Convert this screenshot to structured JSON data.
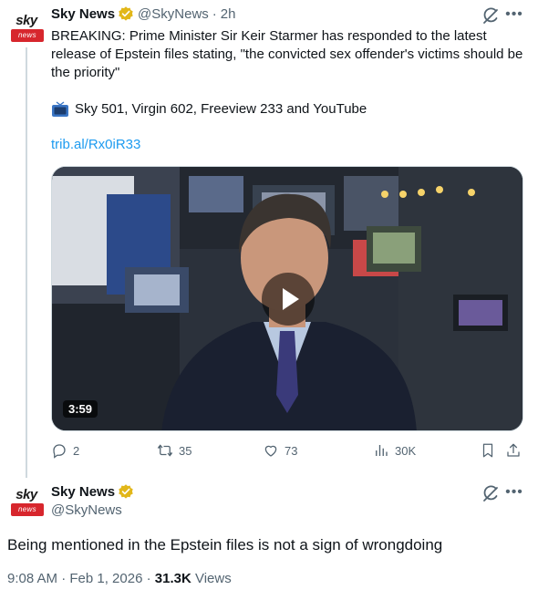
{
  "tweet1": {
    "avatar": {
      "line1": "sky",
      "line2": "news"
    },
    "name": "Sky News",
    "handle": "@SkyNews",
    "separator": "·",
    "time": "2h",
    "text": "BREAKING: Prime Minister Sir Keir Starmer has responded to the latest release of Epstein files stating, \"the convicted sex offender's victims should be the priority\"",
    "channels": "Sky 501, Virgin 602, Freeview 233 and YouTube",
    "link": "trib.al/Rx0iR33",
    "video": {
      "duration": "3:59"
    },
    "actions": {
      "replies": "2",
      "reposts": "35",
      "likes": "73",
      "views": "30K"
    }
  },
  "tweet2": {
    "avatar": {
      "line1": "sky",
      "line2": "news"
    },
    "name": "Sky News",
    "handle": "@SkyNews",
    "text": "Being mentioned in the Epstein files is not a sign of wrongdoing",
    "timestamp": "9:08 AM · Feb 1, 2026 · ",
    "views_count": "31.3K",
    "views_label": " Views"
  },
  "colors": {
    "verified": "#f4b400",
    "link": "#1d9bf0",
    "muted": "#536471",
    "brand_red": "#d7262d"
  },
  "icons": [
    "grok-icon",
    "more-icon",
    "tv-icon",
    "reply-icon",
    "repost-icon",
    "like-icon",
    "views-icon",
    "bookmark-icon",
    "share-icon",
    "verified-badge-icon",
    "play-icon"
  ]
}
